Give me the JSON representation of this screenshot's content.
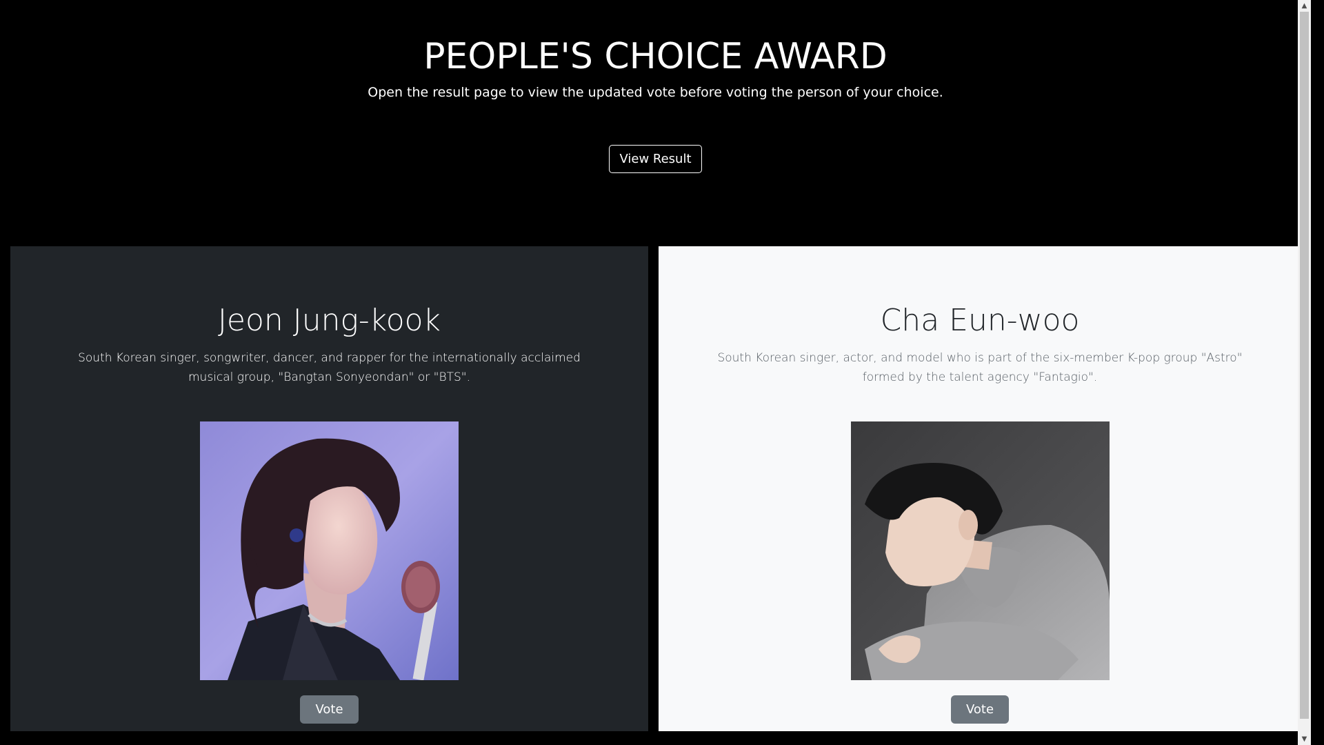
{
  "header": {
    "title": "PEOPLE'S CHOICE AWARD",
    "subtitle": "Open the result page to view the updated vote before voting the person of your choice.",
    "view_result_label": "View Result"
  },
  "candidates": [
    {
      "name": "Jeon Jung-kook",
      "bio": "South Korean singer, songwriter, dancer, and rapper for the internationally acclaimed musical group, \"Bangtan Sonyeondan\" or \"BTS\".",
      "vote_label": "Vote",
      "theme": "dark"
    },
    {
      "name": "Cha Eun-woo",
      "bio": "South Korean singer, actor, and model who is part of the six-member K-pop group \"Astro\" formed by the talent agency \"Fantagio\".",
      "vote_label": "Vote",
      "theme": "light"
    }
  ],
  "colors": {
    "page_bg": "#000000",
    "dark_card_bg": "#212529",
    "light_card_bg": "#f8f9fa",
    "vote_button_bg": "#6c757d"
  },
  "icons": {
    "scroll_up": "chevron-up-icon",
    "scroll_down": "chevron-down-icon"
  }
}
